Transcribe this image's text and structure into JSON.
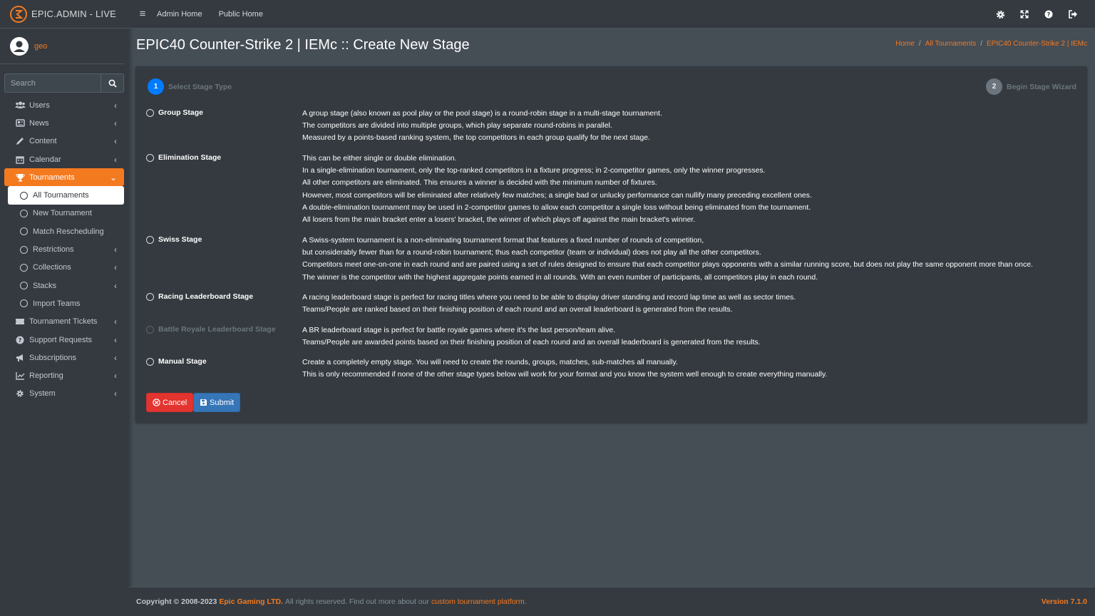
{
  "brand": {
    "name": "EPIC.ADMIN - LIVE"
  },
  "user": {
    "name": "geo"
  },
  "search": {
    "placeholder": "Search"
  },
  "sidebar": {
    "items": [
      {
        "label": "Users",
        "icon": "users-icon"
      },
      {
        "label": "News",
        "icon": "newspaper-icon"
      },
      {
        "label": "Content",
        "icon": "pencil-icon"
      },
      {
        "label": "Calendar",
        "icon": "calendar-icon"
      },
      {
        "label": "Tournaments",
        "icon": "trophy-icon"
      },
      {
        "label": "All Tournaments"
      },
      {
        "label": "New Tournament"
      },
      {
        "label": "Match Rescheduling"
      },
      {
        "label": "Restrictions"
      },
      {
        "label": "Collections"
      },
      {
        "label": "Stacks"
      },
      {
        "label": "Import Teams"
      },
      {
        "label": "Tournament Tickets",
        "icon": "ticket-icon"
      },
      {
        "label": "Support Requests",
        "icon": "question-circle-icon"
      },
      {
        "label": "Subscriptions",
        "icon": "bullhorn-icon"
      },
      {
        "label": "Reporting",
        "icon": "chart-line-icon"
      },
      {
        "label": "System",
        "icon": "gear-icon"
      }
    ]
  },
  "topbar": {
    "admin_home": "Admin Home",
    "public_home": "Public Home"
  },
  "page": {
    "title": "EPIC40 Counter-Strike 2 | IEMc :: Create New Stage",
    "breadcrumb": [
      "Home",
      "All Tournaments",
      "EPIC40 Counter-Strike 2 | IEMc"
    ]
  },
  "stepper": {
    "steps": [
      {
        "num": "1",
        "label": "Select Stage Type"
      },
      {
        "num": "2",
        "label": "Begin Stage Wizard"
      }
    ]
  },
  "options": [
    {
      "label": "Group Stage",
      "lines": [
        "A group stage (also known as pool play or the pool stage) is a round-robin stage in a multi-stage tournament.",
        "The competitors are divided into multiple groups, which play separate round-robins in parallel.",
        "Measured by a points-based ranking system, the top competitors in each group qualify for the next stage."
      ]
    },
    {
      "label": "Elimination Stage",
      "lines": [
        "This can be either single or double elimination.",
        "In a single-elimination tournament, only the top-ranked competitors in a fixture progress; in 2-competitor games, only the winner progresses.",
        "All other competitors are eliminated. This ensures a winner is decided with the minimum number of fixtures.",
        "However, most competitors will be eliminated after relatively few matches; a single bad or unlucky performance can nullify many preceding excellent ones.",
        "A double-elimination tournament may be used in 2-competitor games to allow each competitor a single loss without being eliminated from the tournament.",
        "All losers from the main bracket enter a losers' bracket, the winner of which plays off against the main bracket's winner."
      ]
    },
    {
      "label": "Swiss Stage",
      "lines": [
        "A Swiss-system tournament is a non-eliminating tournament format that features a fixed number of rounds of competition,",
        "but considerably fewer than for a round-robin tournament; thus each competitor (team or individual) does not play all the other competitors.",
        "Competitors meet one-on-one in each round and are paired using a set of rules designed to ensure that each competitor plays opponents with a similar running score, but does not play the same opponent more than once.",
        "The winner is the competitor with the highest aggregate points earned in all rounds. With an even number of participants, all competitors play in each round."
      ]
    },
    {
      "label": "Racing Leaderboard Stage",
      "lines": [
        "A racing leaderboard stage is perfect for racing titles where you need to be able to display driver standing and record lap time as well as sector times.",
        "Teams/People are ranked based on their finishing position of each round and an overall leaderboard is generated from the results."
      ]
    },
    {
      "label": "Battle Royale Leaderboard Stage",
      "disabled": true,
      "lines": [
        "A BR leaderboard stage is perfect for battle royale games where it's the last person/team alive.",
        "Teams/People are awarded points based on their finishing position of each round and an overall leaderboard is generated from the results."
      ]
    },
    {
      "label": "Manual Stage",
      "lines": [
        "Create a completely empty stage. You will need to create the rounds, groups, matches, sub-matches all manually.",
        "This is only recommended if none of the other stage types below will work for your format and you know the system well enough to create everything manually."
      ]
    }
  ],
  "buttons": {
    "cancel": "Cancel",
    "submit": "Submit"
  },
  "footer": {
    "copyright": "Copyright © 2008-2023",
    "company": "Epic Gaming LTD.",
    "rights": "All rights reserved. Find out more about our",
    "link": "custom tournament platform.",
    "version": "Version 7.1.0"
  },
  "colors": {
    "accent": "#f47a20",
    "primary": "#007bff",
    "danger": "#e3342f",
    "submit": "#3575b8",
    "sidebar_bg": "#343a40",
    "content_bg": "#454d55"
  }
}
